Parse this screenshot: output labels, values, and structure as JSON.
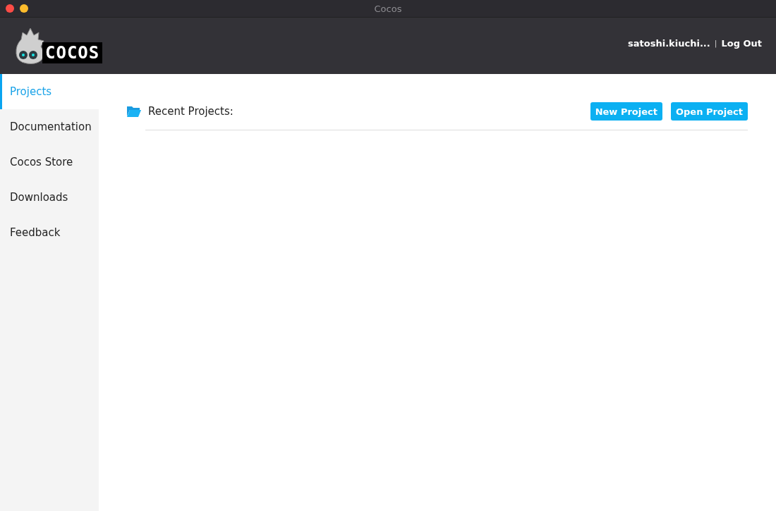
{
  "window": {
    "title": "Cocos"
  },
  "header": {
    "logo_text": "COCOS",
    "username": "satoshi.kiuchi...",
    "separator": "|",
    "logout": "Log Out"
  },
  "sidebar": {
    "items": [
      {
        "label": "Projects",
        "selected": true
      },
      {
        "label": "Documentation",
        "selected": false
      },
      {
        "label": "Cocos Store",
        "selected": false
      },
      {
        "label": "Downloads",
        "selected": false
      },
      {
        "label": "Feedback",
        "selected": false
      }
    ]
  },
  "main": {
    "heading": "Recent Projects:",
    "buttons": [
      "New Project",
      "Open Project"
    ]
  }
}
